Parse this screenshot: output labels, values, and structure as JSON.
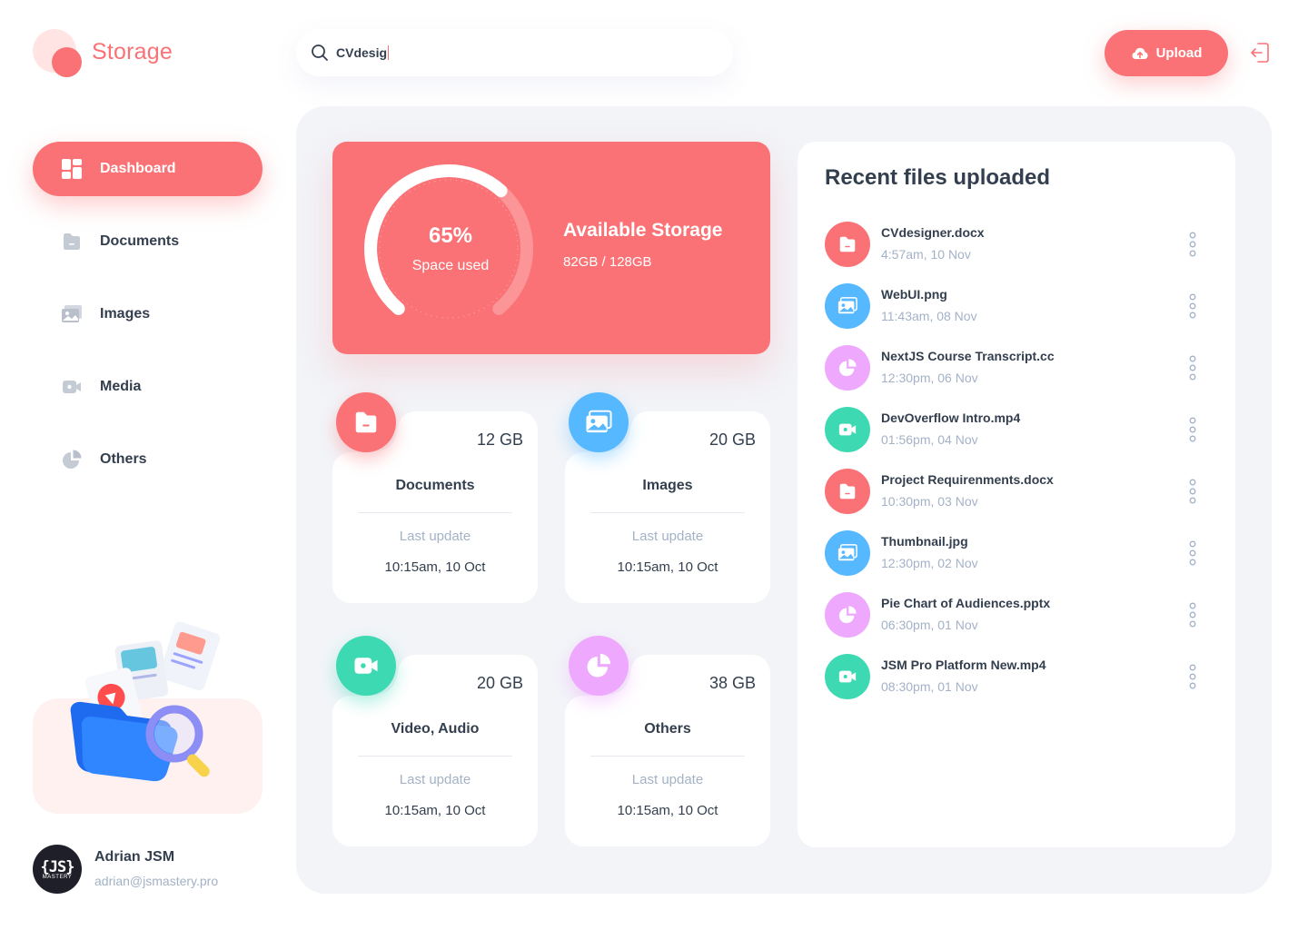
{
  "app": {
    "logo_text": "Storage"
  },
  "search": {
    "value": "CVdesig"
  },
  "header": {
    "upload_label": "Upload"
  },
  "sidebar": {
    "items": [
      {
        "label": "Dashboard",
        "icon": "dashboard-icon",
        "active": true
      },
      {
        "label": "Documents",
        "icon": "document-icon",
        "active": false
      },
      {
        "label": "Images",
        "icon": "image-icon",
        "active": false
      },
      {
        "label": "Media",
        "icon": "video-icon",
        "active": false
      },
      {
        "label": "Others",
        "icon": "pie-chart-icon",
        "active": false
      }
    ]
  },
  "user": {
    "name": "Adrian JSM",
    "email": "adrian@jsmastery.pro",
    "avatar_text": "{JS}",
    "avatar_sub": "MASTERY"
  },
  "storage": {
    "percent": 65,
    "percent_label": "65%",
    "used_label": "Space used",
    "title": "Available Storage",
    "amount": "82GB / 128GB"
  },
  "categories": [
    {
      "name": "Documents",
      "size": "12 GB",
      "last_update_label": "Last update",
      "last_update": "10:15am, 10 Oct",
      "icon": "document-icon",
      "color": "#FA7275"
    },
    {
      "name": "Images",
      "size": "20 GB",
      "last_update_label": "Last update",
      "last_update": "10:15am, 10 Oct",
      "icon": "image-icon",
      "color": "#56B8FF"
    },
    {
      "name": "Video, Audio",
      "size": "20 GB",
      "last_update_label": "Last update",
      "last_update": "10:15am, 10 Oct",
      "icon": "video-icon",
      "color": "#3DD9B3"
    },
    {
      "name": "Others",
      "size": "38 GB",
      "last_update_label": "Last update",
      "last_update": "10:15am, 10 Oct",
      "icon": "pie-chart-icon",
      "color": "#EEA8FD"
    }
  ],
  "recent": {
    "title": "Recent files uploaded",
    "files": [
      {
        "name": "CVdesigner.docx",
        "time": "4:57am, 10 Nov",
        "type": "document",
        "color": "#FA7275"
      },
      {
        "name": "WebUI.png",
        "time": "11:43am, 08 Nov",
        "type": "image",
        "color": "#56B8FF"
      },
      {
        "name": "NextJS Course Transcript.cc",
        "time": "12:30pm, 06 Nov",
        "type": "other",
        "color": "#EEA8FD"
      },
      {
        "name": "DevOverflow Intro.mp4",
        "time": "01:56pm, 04 Nov",
        "type": "video",
        "color": "#3DD9B3"
      },
      {
        "name": "Project Requirenments.docx",
        "time": "10:30pm, 03 Nov",
        "type": "document",
        "color": "#FA7275"
      },
      {
        "name": "Thumbnail.jpg",
        "time": "12:30pm, 02 Nov",
        "type": "image",
        "color": "#56B8FF"
      },
      {
        "name": "Pie Chart of Audiences.pptx",
        "time": "06:30pm, 01 Nov",
        "type": "other",
        "color": "#EEA8FD"
      },
      {
        "name": "JSM Pro Platform New.mp4",
        "time": "08:30pm, 01 Nov",
        "type": "video",
        "color": "#3DD9B3"
      }
    ]
  },
  "colors": {
    "brand": "#FA7275",
    "text": "#333F4E",
    "muted": "#A3B2C7",
    "panel": "#F2F4F8"
  }
}
